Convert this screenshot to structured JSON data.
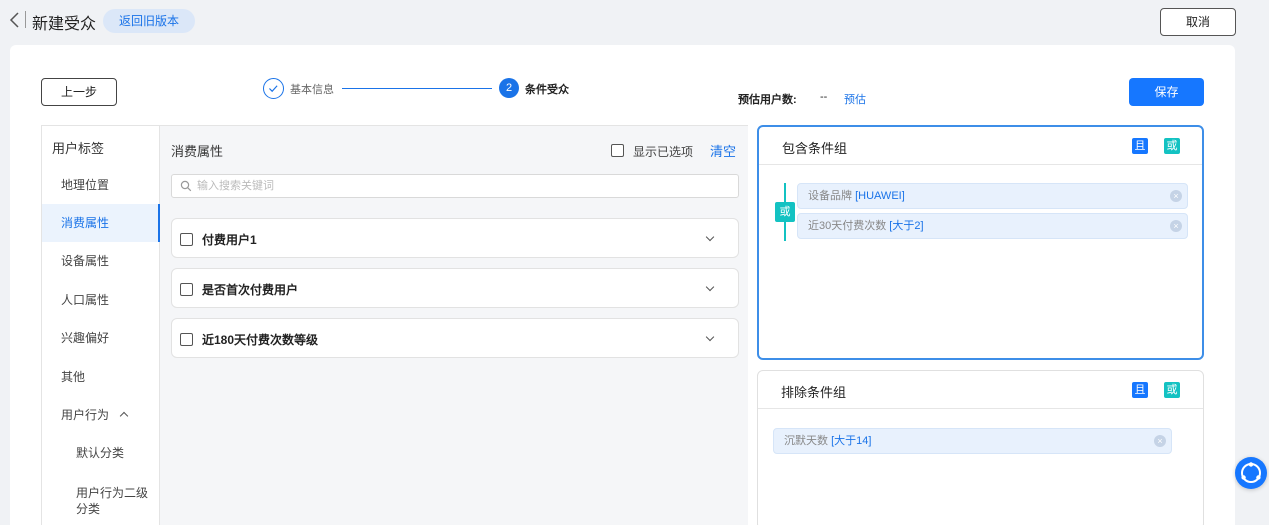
{
  "header": {
    "title": "新建受众",
    "old_version_label": "返回旧版本",
    "cancel_label": "取消"
  },
  "toolbar": {
    "prev_label": "上一步",
    "save_label": "保存"
  },
  "steps": [
    {
      "index": "1",
      "label": "基本信息",
      "status": "done"
    },
    {
      "index": "2",
      "label": "条件受众",
      "status": "active"
    }
  ],
  "estimate": {
    "label": "预估用户数:",
    "value": "--",
    "link": "预估"
  },
  "sidebar": {
    "title": "用户标签",
    "items": [
      {
        "label": "地理位置"
      },
      {
        "label": "消费属性",
        "active": true
      },
      {
        "label": "设备属性"
      },
      {
        "label": "人口属性"
      },
      {
        "label": "兴趣偏好"
      },
      {
        "label": "其他"
      },
      {
        "label": "用户行为",
        "expanded": true
      },
      {
        "label": "默认分类",
        "sub": true
      },
      {
        "label": "用户行为二级分类",
        "sub": true
      }
    ]
  },
  "content": {
    "title": "消费属性",
    "show_selected_label": "显示已选项",
    "clear_label": "清空",
    "search_placeholder": "输入搜索关键词",
    "attributes": [
      {
        "label": "付费用户1"
      },
      {
        "label": "是否首次付费用户"
      },
      {
        "label": "近180天付费次数等级"
      }
    ]
  },
  "include_group": {
    "title": "包含条件组",
    "and_label": "且",
    "or_label": "或",
    "connector": "或",
    "conditions": [
      {
        "name": "设备品牌 ",
        "value": "[HUAWEI]"
      },
      {
        "name": "近30天付费次数 ",
        "value": "[大于2]"
      }
    ]
  },
  "exclude_group": {
    "title": "排除条件组",
    "and_label": "且",
    "or_label": "或",
    "conditions": [
      {
        "name": "沉默天数 ",
        "value": "[大于14]"
      }
    ]
  },
  "colors": {
    "primary": "#1677ff",
    "or_accent": "#13c2c2",
    "tag_bg": "#e8f1fd"
  }
}
